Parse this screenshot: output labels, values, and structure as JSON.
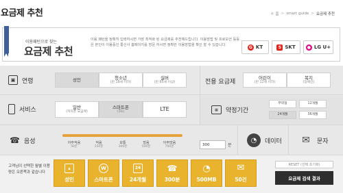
{
  "title": "요금제 추천",
  "breadcrumb": {
    "home": "홈",
    "item1": "smart guide",
    "item2": "요금제 추천"
  },
  "header": {
    "subtitle": "이용패턴으로 찾는",
    "title": "요금제 추천",
    "description": "이용 패턴을 정확히 입력하시면 가장 최적화 된 요금제를 추천해드립니다. 이용방법 및 프로모션 등등은 본인이 이용중인 통신사 홈페이지를 방문 하시면 정확한 이용방법을 확인 할 수 있습니다."
  },
  "carriers": [
    {
      "name": "KT",
      "color": "#e2231a",
      "icon": "kt-logo-icon"
    },
    {
      "name": "SKT",
      "color": "#e2231a",
      "icon": "skt-logo-icon"
    },
    {
      "name": "LG U+",
      "color": "#e6007e",
      "icon": "lguplus-logo-icon"
    }
  ],
  "age": {
    "label": "연령",
    "options": [
      {
        "l1": "성인",
        "l2": "",
        "selected": true
      },
      {
        "l1": "청소년",
        "l2": "(만 18세 이하)",
        "selected": false
      },
      {
        "l1": "실버",
        "l2": "(만 65세 이상)",
        "selected": false
      }
    ]
  },
  "special_plan": {
    "label": "전용 요금제",
    "options": [
      {
        "l1": "어린이",
        "l2": "(만 12세 이하)"
      },
      {
        "l1": "복지",
        "l2": "(장애인)"
      }
    ]
  },
  "service": {
    "label": "서비스",
    "options": [
      {
        "l1": "일반",
        "l2": "(피처폰 요금제)",
        "selected": false
      },
      {
        "l1": "스마트폰",
        "l2": "(3G)",
        "selected": true
      },
      {
        "l1": "LTE",
        "l2": "",
        "selected": false
      }
    ]
  },
  "contract": {
    "label": "약정기간",
    "options": [
      {
        "label": "무약정",
        "selected": false
      },
      {
        "label": "12개월",
        "selected": false
      },
      {
        "label": "24개월",
        "selected": true
      },
      {
        "label": "36개월",
        "selected": false
      }
    ]
  },
  "voice": {
    "label": "음성",
    "ticks": [
      {
        "l1": "아주적음",
        "l2": "50분"
      },
      {
        "l1": "적음",
        "l2": "150분"
      },
      {
        "l1": "보통",
        "l2": "300분"
      },
      {
        "l1": "많음",
        "l2": "500분"
      },
      {
        "l1": "아주많음",
        "l2": "700분"
      }
    ],
    "input_value": "300",
    "unit": "분"
  },
  "data_label": "데이터",
  "sms_label": "문자",
  "result": {
    "description": "고객님이 선택한 월별 이용량은 오른쪽과 같습니다",
    "tiles": [
      {
        "label": "성인",
        "icon": "person-icon",
        "glyph": "👤"
      },
      {
        "label": "스마트폰",
        "icon": "w-icon",
        "glyph": "W"
      },
      {
        "label": "24개월",
        "icon": "calendar-icon",
        "glyph": "24"
      },
      {
        "label": "300분",
        "icon": "phone-icon",
        "glyph": "☎"
      },
      {
        "label": "500MB",
        "icon": "pie-icon",
        "glyph": "◔"
      },
      {
        "label": "50건",
        "icon": "envelope-icon",
        "glyph": "✉"
      }
    ],
    "reset_label": "RESET (선택 초기화)",
    "result_label": "요금제 검색 결과"
  }
}
